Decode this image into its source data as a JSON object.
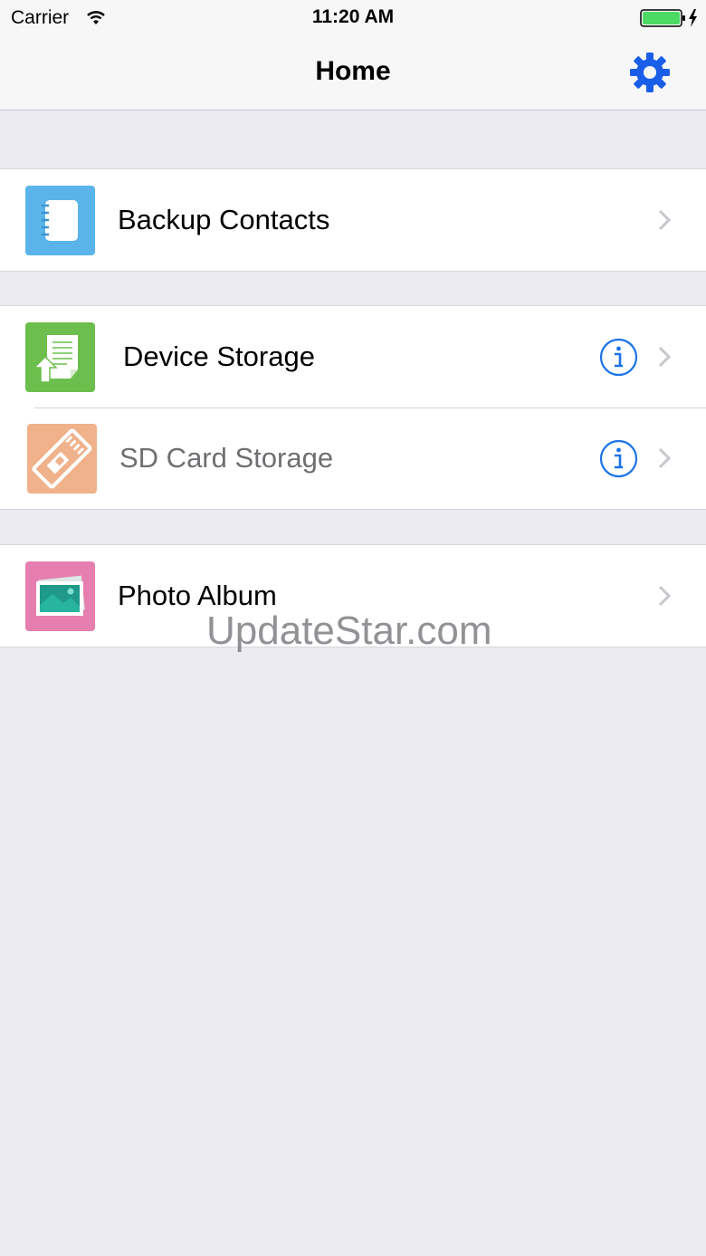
{
  "status_bar": {
    "carrier": "Carrier",
    "time": "11:20 AM"
  },
  "nav": {
    "title": "Home",
    "settings_icon": "gear-icon"
  },
  "groups": [
    {
      "rows": [
        {
          "label": "Backup Contacts",
          "icon": "contacts-book-icon",
          "icon_color": "#5ab4ea",
          "info": false,
          "dim": false
        }
      ]
    },
    {
      "rows": [
        {
          "label": "Device Storage",
          "icon": "device-storage-icon",
          "icon_color": "#6cbf4c",
          "info": true,
          "dim": false
        },
        {
          "label": "SD Card Storage",
          "icon": "sd-card-icon",
          "icon_color": "#efb28b",
          "info": true,
          "dim": true
        }
      ]
    },
    {
      "rows": [
        {
          "label": "Photo Album",
          "icon": "photo-album-icon",
          "icon_color": "#e67eb0",
          "info": false,
          "dim": false
        }
      ]
    }
  ],
  "watermark": "UpdateStar.com",
  "colors": {
    "accent": "#1a73e8",
    "background": "#ebebf1",
    "battery": "#4cd964"
  }
}
